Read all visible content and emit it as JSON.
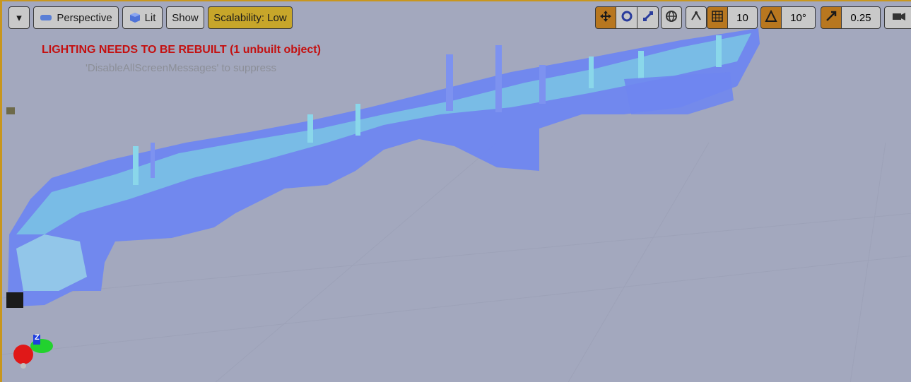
{
  "toolbar": {
    "menu_caret": "▾",
    "perspective_label": "Perspective",
    "lit_label": "Lit",
    "show_label": "Show",
    "scalability_label": "Scalability: Low",
    "grid_snap_value": "10",
    "rotation_snap_value": "10°",
    "scale_snap_value": "0.25"
  },
  "messages": {
    "warning": "LIGHTING NEEDS TO BE REBUILT (1 unbuilt object)",
    "hint": "'DisableAllScreenMessages' to suppress"
  },
  "axis_gizmo": {
    "z_label": "Z"
  },
  "colors": {
    "viewport_bg": "#a3a8be",
    "highlight_border": "#c8961e",
    "warning_text": "#c41010",
    "scalability_bg": "#c7a62a",
    "snap_active": "#b8771f",
    "city_primary": "#6f86f0",
    "city_highlight": "#7fe8e0"
  }
}
